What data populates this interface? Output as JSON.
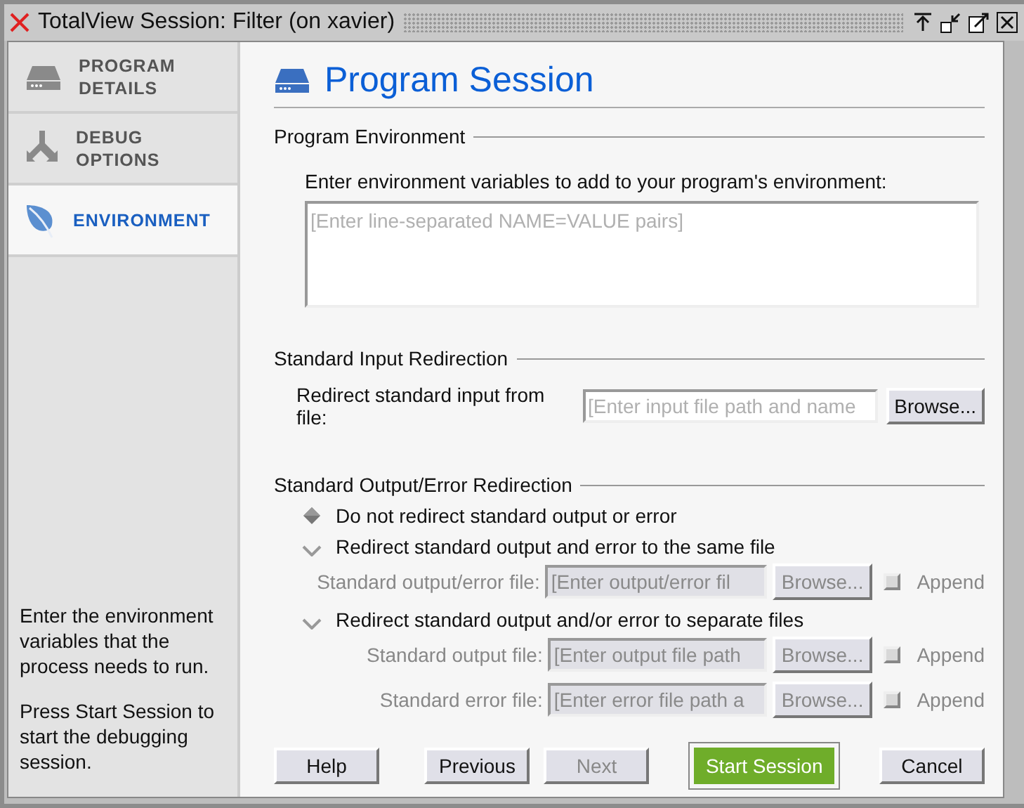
{
  "window": {
    "title": "TotalView Session: Filter (on xavier)"
  },
  "sidebar": {
    "items": [
      {
        "lines": [
          "PROGRAM",
          "DETAILS"
        ],
        "kind": "drive",
        "selected": false
      },
      {
        "lines": [
          "DEBUG",
          "OPTIONS"
        ],
        "kind": "split",
        "selected": false
      },
      {
        "lines": [
          "ENVIRONMENT"
        ],
        "kind": "leaf",
        "selected": true
      }
    ],
    "help": [
      "Enter the environment variables that the process needs to run.",
      "Press Start Session to start the debugging session."
    ]
  },
  "page_title": "Program Session",
  "program_environment": {
    "heading": "Program Environment",
    "instruction": "Enter environment variables to add to your program's environment:",
    "text_area": {
      "placeholder": "[Enter line-separated NAME=VALUE pairs]"
    }
  },
  "input_redirection": {
    "heading": "Standard Input Redirection",
    "label": "Redirect standard input from file:",
    "field": {
      "placeholder": "[Enter input file path and name"
    },
    "browse_button": "Browse..."
  },
  "output_redirection": {
    "heading": "Standard Output/Error Redirection",
    "options": [
      {
        "label": "Do not redirect standard output or error",
        "selected": true
      },
      {
        "label": "Redirect standard output and error to the same file",
        "selected": false,
        "fields": [
          {
            "label": "Standard output/error file:",
            "placeholder": "[Enter output/error fil",
            "disabled": true,
            "browse": "Browse...",
            "append": "Append",
            "checked": false
          }
        ]
      },
      {
        "label": "Redirect standard output and/or error to separate files",
        "selected": false,
        "fields": [
          {
            "label": "Standard output file:",
            "placeholder": "[Enter output file path",
            "disabled": true,
            "browse": "Browse...",
            "append": "Append",
            "checked": false
          },
          {
            "label": "Standard error file:",
            "placeholder": "[Enter error file path a",
            "disabled": true,
            "browse": "Browse...",
            "append": "Append",
            "checked": false
          }
        ]
      }
    ]
  },
  "buttons": [
    {
      "label": "Help",
      "kind": "normal",
      "disabled": false
    },
    {
      "label": "Previous",
      "kind": "normal",
      "disabled": false
    },
    {
      "label": "Next",
      "kind": "normal",
      "disabled": true
    },
    {
      "label": "Start Session",
      "kind": "primary",
      "disabled": false
    },
    {
      "label": "Cancel",
      "kind": "normal",
      "disabled": false
    }
  ]
}
